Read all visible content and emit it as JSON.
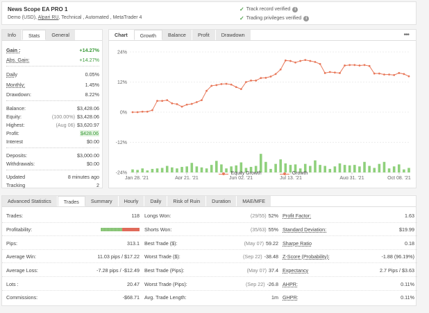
{
  "header": {
    "title": "News Scope EA PRO 1",
    "sub_prefix": "Demo (USD), ",
    "broker": "Alpari RU",
    "sub_suffix": ", Technical , Automated , MetaTrader 4",
    "verified_1": "Track record verified",
    "verified_2": "Trading privileges verified"
  },
  "left_tabs": [
    "Info",
    "Stats",
    "General"
  ],
  "stats": {
    "gain_label": "Gain :",
    "gain": "+14.27%",
    "abs_gain_label": "Abs. Gain:",
    "abs_gain": "+14.27%",
    "daily_label": "Daily",
    "daily": "0.05%",
    "monthly_label": "Monthly:",
    "monthly": "1.45%",
    "drawdown_label": "Drawdown:",
    "drawdown": "8.22%",
    "balance_label": "Balance:",
    "balance": "$3,428.06",
    "equity_label": "Equity:",
    "equity_note": "(100.00%)",
    "equity": "$3,428.06",
    "highest_label": "Highest:",
    "highest_note": "(Aug 06)",
    "highest": "$3,620.97",
    "profit_label": "Profit:",
    "profit": "$428.06",
    "interest_label": "Interest",
    "interest": "$0.00",
    "deposits_label": "Deposits:",
    "deposits": "$3,000.00",
    "withdrawals_label": "Withdrawals:",
    "withdrawals": "$0.00",
    "updated_label": "Updated",
    "updated": "8 minutes ago",
    "tracking_label": "Tracking",
    "tracking": "2"
  },
  "chart_tabs": [
    "Chart",
    "Growth",
    "Balance",
    "Profit",
    "Drawdown"
  ],
  "chart_more": "•••",
  "chart_data": {
    "type": "line",
    "y_ticks": [
      "24%",
      "12%",
      "0%",
      "-12%",
      "-24%"
    ],
    "ylim": [
      -24,
      24
    ],
    "x_ticks": [
      "Jan 28, '21",
      "Apr 21, '21",
      "Jun 02, '21",
      "Jul 13, '21",
      "Aug 31, '21",
      "Oct 08, '21"
    ],
    "series": [
      {
        "name": "Equity Growth",
        "values": [
          0,
          0,
          0.2,
          0.2,
          0.8,
          4.5,
          4.5,
          4.8,
          3.5,
          3.2,
          2.2,
          3.0,
          3.3,
          4.0,
          4.8,
          8.5,
          10.5,
          10.8,
          11.2,
          11.3,
          11.0,
          10.0,
          9.2,
          12.0,
          12.6,
          12.6,
          13.6,
          13.7,
          14.2,
          15.2,
          17.0,
          20.6,
          20.4,
          19.8,
          20.4,
          20.8,
          20.4,
          20.0,
          19.2,
          15.6,
          16.0,
          15.8,
          15.6,
          18.6,
          18.8,
          18.8,
          18.6,
          18.8,
          18.4,
          15.4,
          15.4,
          15.0,
          15.0,
          14.8,
          15.6,
          15.2,
          14.3
        ]
      },
      {
        "name": "Growth",
        "values": [
          1.2,
          1.0,
          1.6,
          0.8,
          1.4,
          1.6,
          1.8,
          2.6,
          2.0,
          1.6,
          2.2,
          2.4,
          3.8,
          2.4,
          2.0,
          1.6,
          3.0,
          4.6,
          3.2,
          1.6,
          2.4,
          2.8,
          4.0,
          1.8,
          2.2,
          2.6,
          7.4,
          4.2,
          1.4,
          3.4,
          5.2,
          3.6,
          3.0,
          3.2,
          1.6,
          3.4,
          2.6,
          4.8,
          3.0,
          2.6,
          1.4,
          2.4,
          3.6,
          3.0,
          2.8,
          3.0,
          2.4,
          4.2,
          2.6,
          1.8,
          3.4,
          4.2,
          1.6,
          2.4,
          3.2,
          1.2,
          1.8
        ]
      }
    ]
  },
  "legend": {
    "equity": "Equity Growth",
    "growth": "Growth"
  },
  "adv_tabs": [
    "Advanced Statistics",
    "Trades",
    "Summary",
    "Hourly",
    "Daily",
    "Risk of Ruin",
    "Duration",
    "MAE/MFE"
  ],
  "profitability": {
    "win_pct": 55,
    "loss_pct": 45
  },
  "adv_rows": [
    {
      "l1": "Trades:",
      "v1": "118",
      "l2": "Longs Won:",
      "n2": "(29/55)",
      "v2": "52%",
      "l3": "Profit Factor:",
      "v3": "1.63"
    },
    {
      "l1": "Profitability:",
      "v1": "",
      "l2": "Shorts Won:",
      "n2": "(35/63)",
      "v2": "55%",
      "l3": "Standard Deviation:",
      "v3": "$19.99"
    },
    {
      "l1": "Pips:",
      "v1": "313.1",
      "l2": "Best Trade ($):",
      "n2": "(May 07)",
      "v2": "59.22",
      "l3": "Sharpe Ratio",
      "v3": "0.18"
    },
    {
      "l1": "Average Win:",
      "v1": "11.03 pips / $17.22",
      "l2": "Worst Trade ($):",
      "n2": "(Sep 22)",
      "v2": "-38.48",
      "l3": "Z-Score (Probability):",
      "v3": "-1.88 (96.19%)"
    },
    {
      "l1": "Average Loss:",
      "v1": "-7.28 pips / -$12.49",
      "l2": "Best Trade (Pips):",
      "n2": "(May 07)",
      "v2": "37.4",
      "l3": "Expectancy",
      "v3": "2.7 Pips / $3.63"
    },
    {
      "l1": "Lots :",
      "v1": "20.47",
      "l2": "Worst Trade (Pips):",
      "n2": "(Sep 22)",
      "v2": "-26.8",
      "l3": "AHPR:",
      "v3": "0.11%"
    },
    {
      "l1": "Commissions:",
      "v1": "-$68.71",
      "l2": "Avg. Trade Length:",
      "n2": "",
      "v2": "1m",
      "l3": "GHPR:",
      "v3": "0.11%"
    }
  ],
  "colors": {
    "line": "#e8785a",
    "bars": "#8fd07c",
    "green_text": "#3a9a38",
    "check": "#52a44e"
  }
}
